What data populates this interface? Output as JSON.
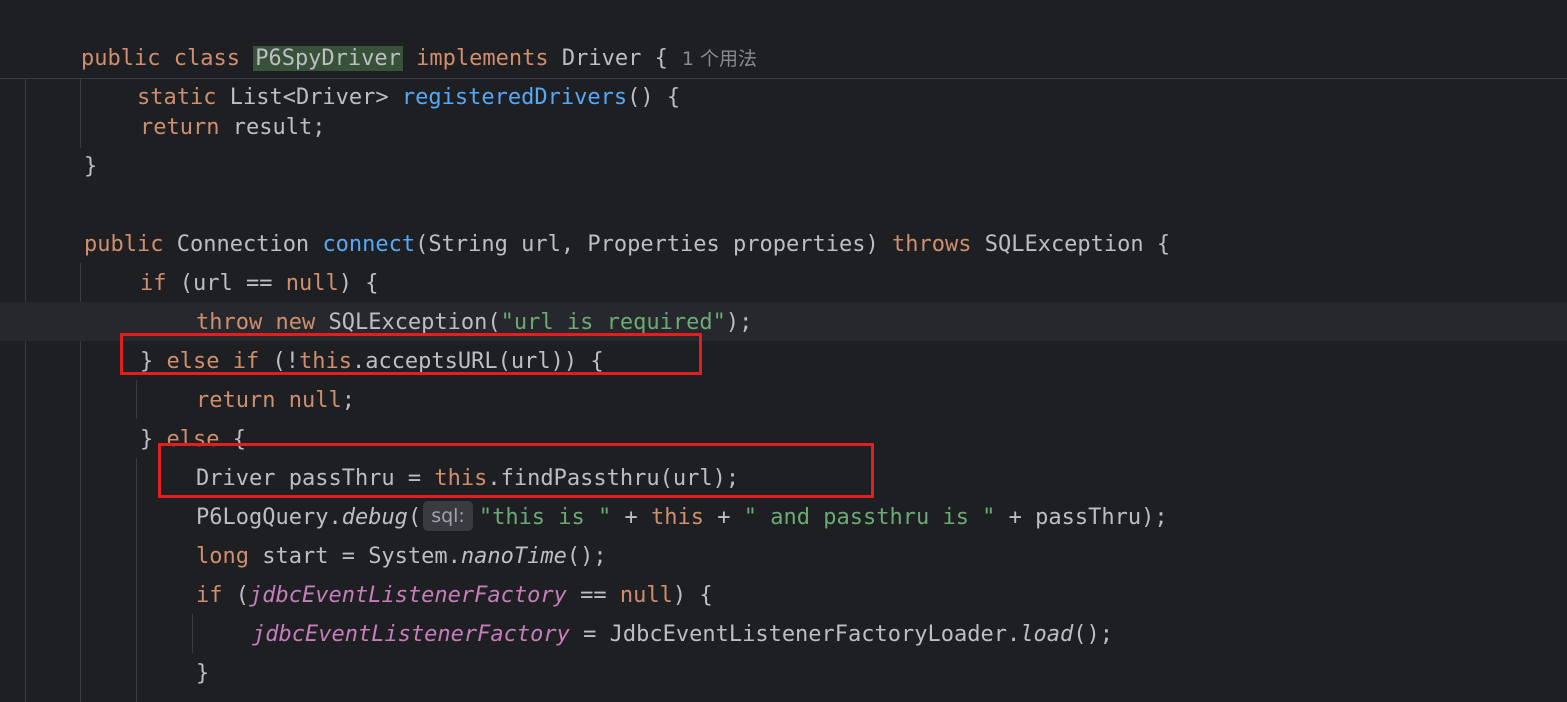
{
  "sticky_header": {
    "line1": {
      "kw_public": "public",
      "kw_class": "class",
      "class_name": "P6SpyDriver",
      "kw_implements": "implements",
      "iface": "Driver {",
      "usage_hint": "1 个用法"
    },
    "line2": {
      "kw_static": "static",
      "type": "List<Driver>",
      "method": "registeredDrivers",
      "rest": "() {"
    }
  },
  "code": {
    "l_return_kw": "return",
    "l_return_rest": " result;",
    "l_close1": "}",
    "l_conn_public": "public",
    "l_conn_type": " Connection ",
    "l_conn_method": "connect",
    "l_conn_params": "(String url, Properties properties) ",
    "l_conn_throws": "throws",
    "l_conn_exc": " SQLException {",
    "l_if_kw": "if",
    "l_if_mid": " (url == ",
    "l_if_null": "null",
    "l_if_end": ") {",
    "l_throw_kw": "throw",
    "l_throw_new": " new",
    "l_throw_exc": " SQLException(",
    "l_throw_str": "\"url is required\"",
    "l_throw_end": ");",
    "l_elseif_b": "} ",
    "l_elseif_else": "else if",
    "l_elseif_mid": " (!",
    "l_elseif_this": "this",
    "l_elseif_end": ".acceptsURL(url)) {",
    "l_retnull_kw": "return",
    "l_retnull_null": " null",
    "l_retnull_end": ";",
    "l_else_b": "} ",
    "l_else_kw": "else",
    "l_else_end": " {",
    "l_driver_a": "Driver passThru = ",
    "l_driver_this": "this",
    "l_driver_end": ".findPassthru(url);",
    "l_log_a": "P6LogQuery.",
    "l_log_debug": "debug",
    "l_log_paren": "(",
    "l_log_hint": "sql:",
    "l_log_s1": "\"this is \"",
    "l_log_plus1": " + ",
    "l_log_this": "this",
    "l_log_plus2": " + ",
    "l_log_s2": "\" and passthru is \"",
    "l_log_end": " + passThru);",
    "l_long_kw": "long",
    "l_long_mid": " start = System.",
    "l_long_nano": "nanoTime",
    "l_long_end": "();",
    "l_if2_kw": "if",
    "l_if2_a": " (",
    "l_if2_field": "jdbcEventListenerFactory",
    "l_if2_b": " == ",
    "l_if2_null": "null",
    "l_if2_end": ") {",
    "l_assign_field": "jdbcEventListenerFactory",
    "l_assign_mid": " = JdbcEventListenerFactoryLoader.",
    "l_assign_load": "load",
    "l_assign_end": "();",
    "l_close2": "}"
  }
}
